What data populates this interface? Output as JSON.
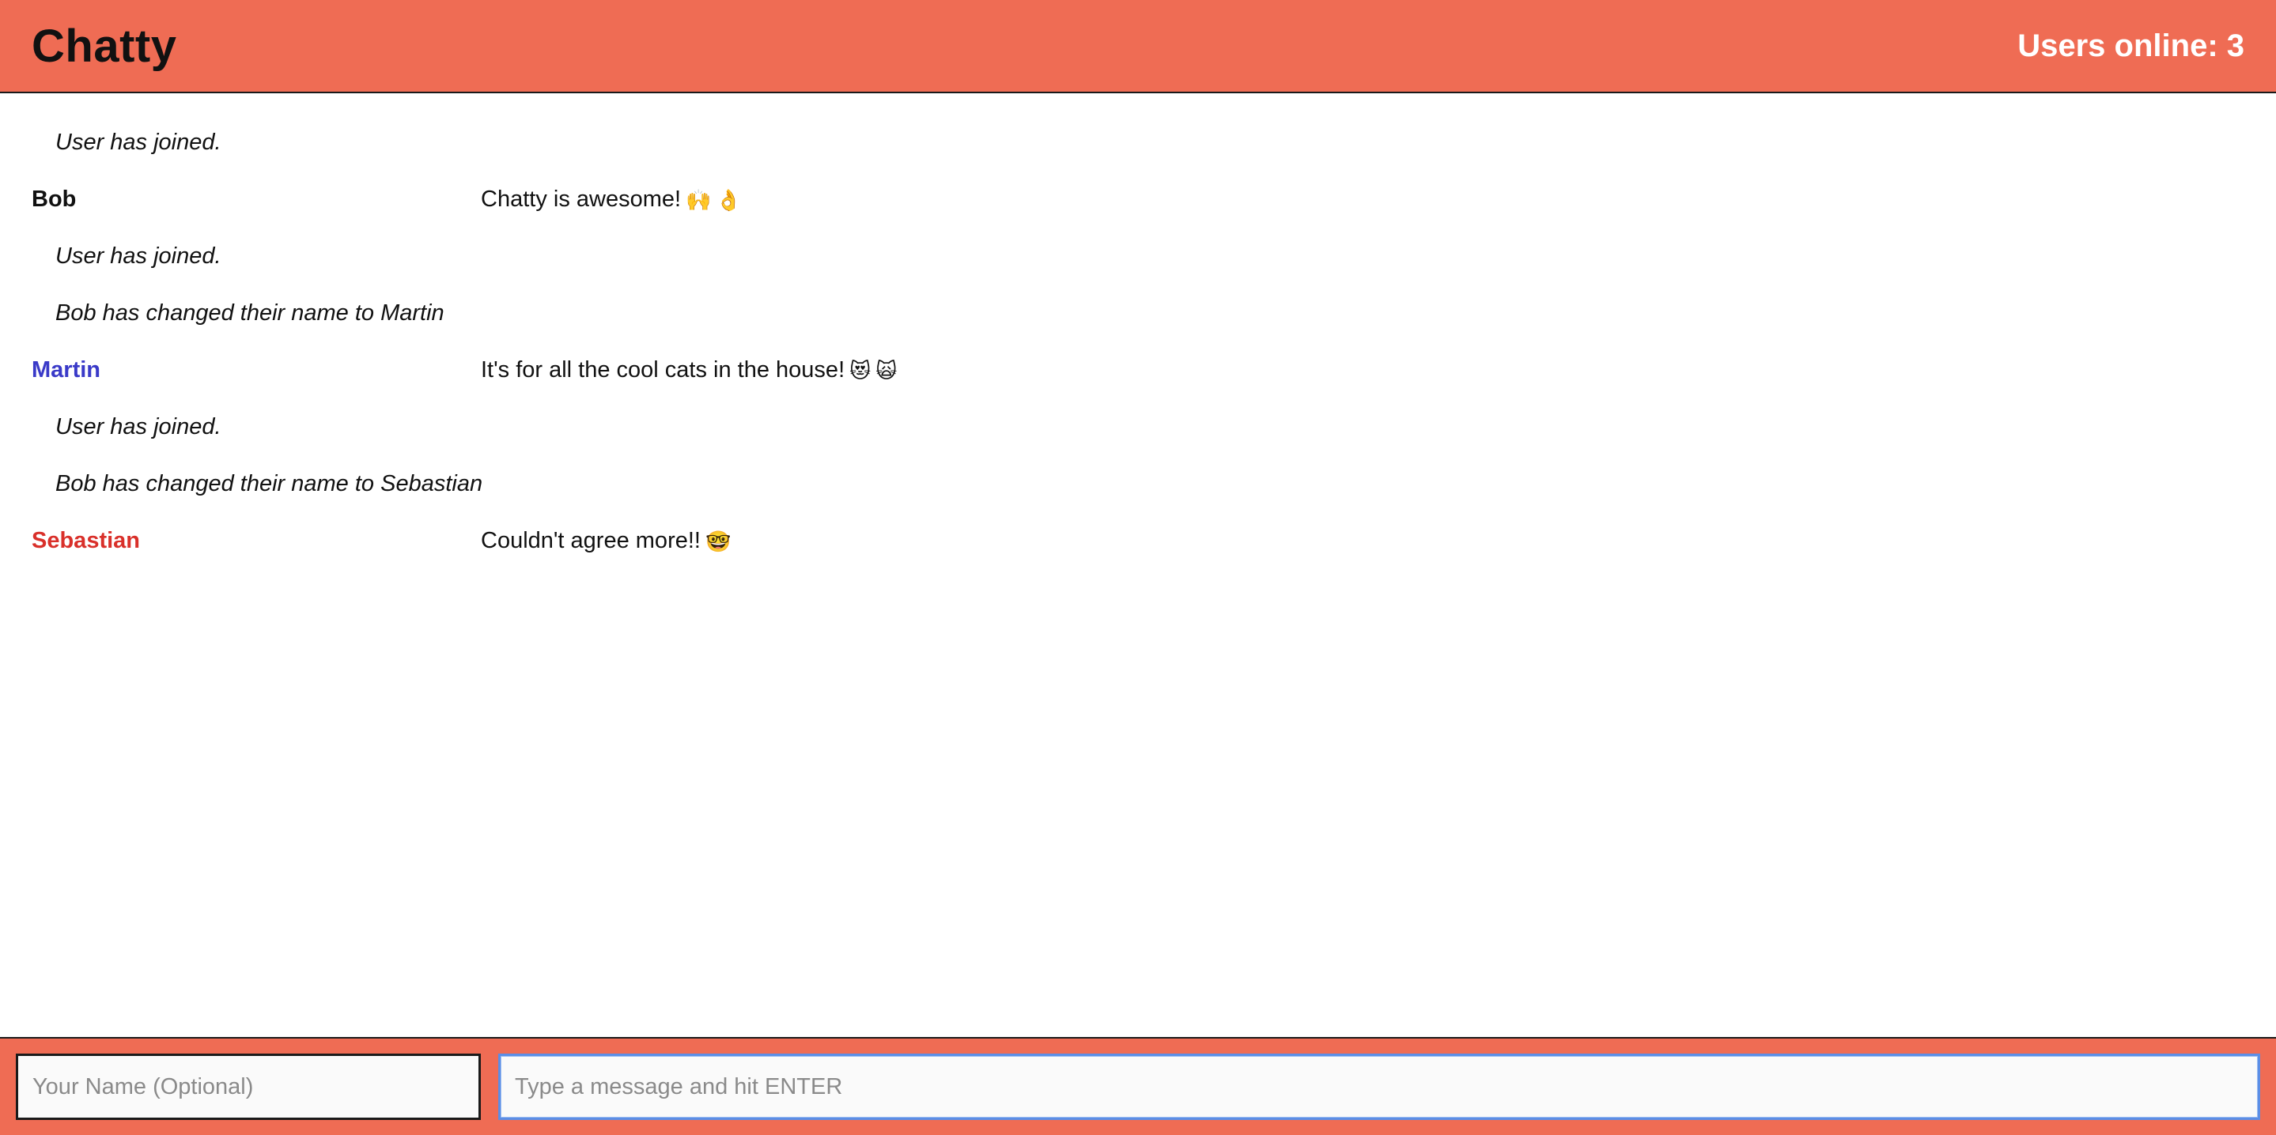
{
  "navbar": {
    "brand": "Chatty",
    "users_online": "Users online: 3"
  },
  "messages": [
    {
      "type": "system",
      "text": "User has joined."
    },
    {
      "type": "chat",
      "username": "Bob",
      "username_color": "#111111",
      "text": "Chatty is awesome!",
      "emoji": [
        "🙌",
        "👌"
      ]
    },
    {
      "type": "system",
      "text": "User has joined."
    },
    {
      "type": "system",
      "text": "Bob has changed their name to Martin"
    },
    {
      "type": "chat",
      "username": "Martin",
      "username_color": "#3a3ac8",
      "text": "It's for all the cool cats in the house!",
      "emoji": [
        "😻",
        "🙀"
      ]
    },
    {
      "type": "system",
      "text": "User has joined."
    },
    {
      "type": "system",
      "text": "Bob has changed their name to Sebastian"
    },
    {
      "type": "chat",
      "username": "Sebastian",
      "username_color": "#d9302a",
      "text": "Couldn't agree more!!",
      "emoji": [
        "🤓"
      ]
    }
  ],
  "composer": {
    "name_placeholder": "Your Name (Optional)",
    "name_value": "",
    "message_placeholder": "Type a message and hit ENTER",
    "message_value": ""
  },
  "colors": {
    "bar": "#ef6c54",
    "brand_text": "#111111",
    "users_online_text": "#ffffff"
  }
}
